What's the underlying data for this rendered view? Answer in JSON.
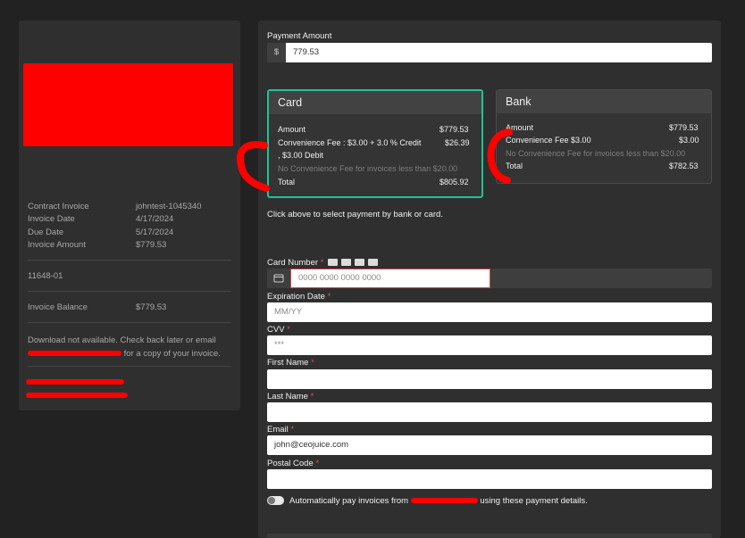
{
  "invoice": {
    "rows": [
      {
        "label": "Contract Invoice",
        "value": "johntest-1045340"
      },
      {
        "label": "Invoice Date",
        "value": "4/17/2024"
      },
      {
        "label": "Due Date",
        "value": "5/17/2024"
      },
      {
        "label": "Invoice Amount",
        "value": "$779.53"
      }
    ],
    "account_number": "11648-01",
    "balance_label": "Invoice Balance",
    "balance_value": "$779.53",
    "download_text_1": "Download not available. Check back later or email",
    "download_text_2": "for a copy of your invoice."
  },
  "payment": {
    "amount_label": "Payment Amount",
    "currency_symbol": "$",
    "amount_value": "779.53",
    "card": {
      "title": "Card",
      "amount_label": "Amount",
      "amount_value": "$779.53",
      "fee_label_1": "Convenience Fee : $3.00 + 3.0 % Credit",
      "fee_label_2": ", $3.00 Debit",
      "fee_value": "$26.39",
      "no_fee_note": "No Convenience Fee for invoices less than $20.00",
      "total_label": "Total",
      "total_value": "$805.92"
    },
    "bank": {
      "title": "Bank",
      "amount_label": "Amount",
      "amount_value": "$779.53",
      "fee_label": "Convenience Fee  $3.00",
      "fee_value": "$3.00",
      "no_fee_note": "No Convenience Fee for invoices less than $20.00",
      "total_label": "Total",
      "total_value": "$782.53"
    },
    "select_hint": "Click above to select payment by bank or card."
  },
  "form": {
    "card_number_label": "Card Number",
    "card_number_placeholder": "0000 0000 0000 0000",
    "expiration_label": "Expiration Date",
    "expiration_placeholder": "MM/YY",
    "cvv_label": "CVV",
    "cvv_placeholder": "***",
    "first_name_label": "First Name",
    "last_name_label": "Last Name",
    "email_label": "Email",
    "email_value": "john@ceojuice.com",
    "postal_label": "Postal Code",
    "required_mark": "*",
    "auto_pay_text_1": "Automatically pay invoices from",
    "auto_pay_text_2": "using these payment details."
  },
  "colors": {
    "selected_border": "#1ec394",
    "redaction": "#ff0000",
    "panel": "#2f2f2f",
    "background": "#222222"
  },
  "icons": [
    "card-icon",
    "visa-icon",
    "mastercard-icon",
    "amex-icon",
    "discover-icon"
  ]
}
